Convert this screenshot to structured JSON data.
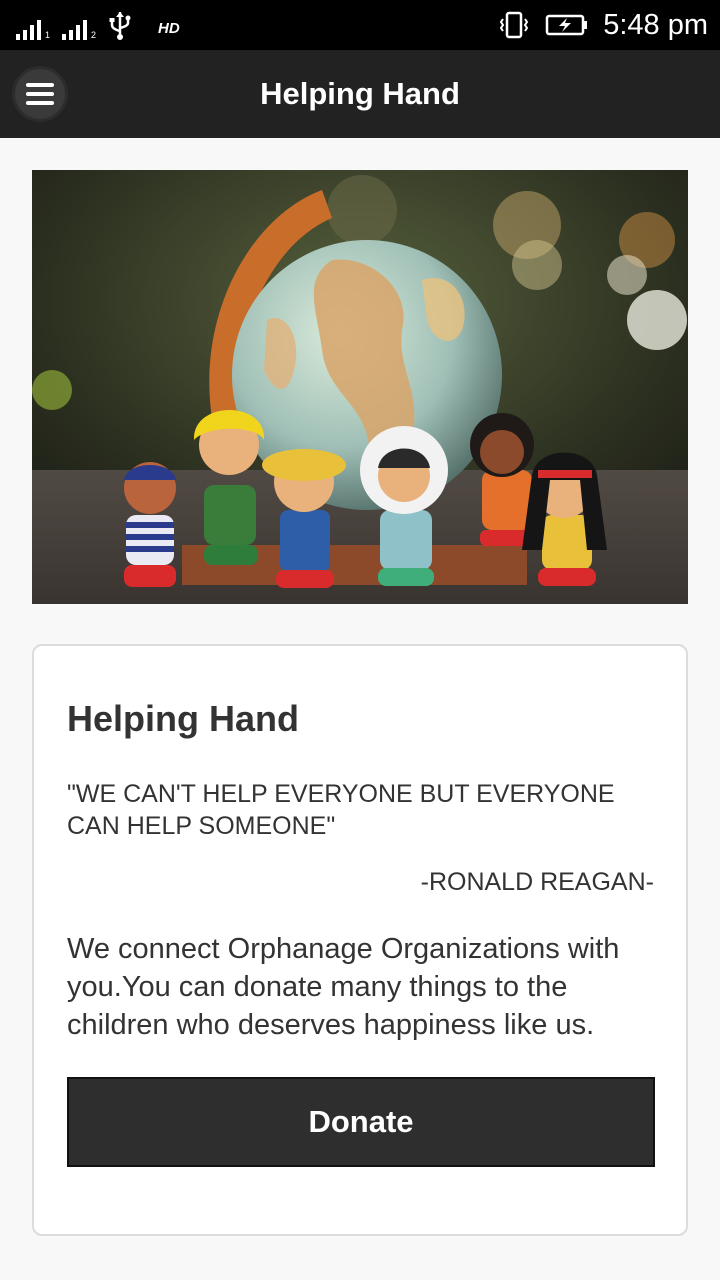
{
  "status_bar": {
    "time": "5:48 pm",
    "sim1_label": "1",
    "sim2_label": "2",
    "hd_label": "HD",
    "icons": [
      "signal-icon",
      "usb-icon",
      "vibrate-icon",
      "battery-charging-icon"
    ]
  },
  "app_bar": {
    "title": "Helping Hand",
    "menu_icon": "hamburger-menu-icon",
    "background": "#222222"
  },
  "hero": {
    "subject": "globe-with-toy-children"
  },
  "card": {
    "title": "Helping Hand",
    "quote": "\"WE CAN'T HELP EVERYONE BUT EVERYONE CAN HELP SOMEONE\"",
    "author": "-RONALD REAGAN-",
    "description": "We connect Orphanage Organizations with you.You can donate many things to the children who deserves happiness like us.",
    "donate_label": "Donate"
  },
  "colors": {
    "accent": "#2e2e2e",
    "page_background": "#f8f8f8",
    "text": "#333333"
  }
}
